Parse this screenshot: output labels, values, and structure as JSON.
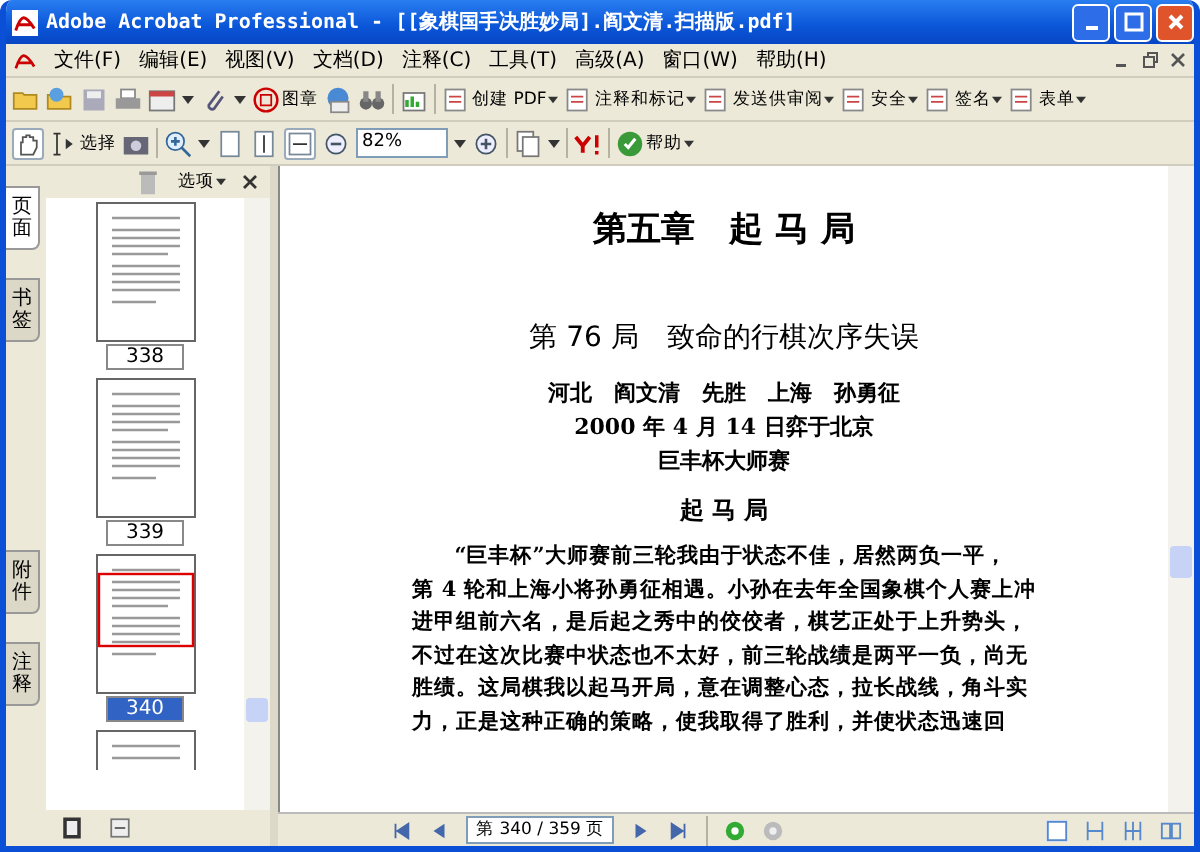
{
  "window": {
    "title": "Adobe Acrobat Professional - [[象棋国手决胜妙局].阎文清.扫描版.pdf]"
  },
  "menu": [
    "文件(F)",
    "编辑(E)",
    "视图(V)",
    "文档(D)",
    "注释(C)",
    "工具(T)",
    "高级(A)",
    "窗口(W)",
    "帮助(H)"
  ],
  "toolbar": {
    "stamp": "图章",
    "tasks": [
      "创建 PDF",
      "注释和标记",
      "发送供审阅",
      "安全",
      "签名",
      "表单"
    ]
  },
  "toolbar2": {
    "select": "选择",
    "zoom": "82%",
    "help": "帮助"
  },
  "side_tabs": [
    {
      "label": "页面",
      "selected": true
    },
    {
      "label": "书签",
      "selected": false
    },
    {
      "label": "附件",
      "selected": false
    },
    {
      "label": "注释",
      "selected": false
    }
  ],
  "panel": {
    "options": "选项",
    "thumbnails": [
      {
        "page": "338",
        "selected": false
      },
      {
        "page": "339",
        "selected": false
      },
      {
        "page": "340",
        "selected": true
      }
    ]
  },
  "document": {
    "chapter": "第五章　起 马 局",
    "game": "第 76 局　致命的行棋次序失误",
    "players": "河北　阎文清　先胜　上海　孙勇征",
    "date": "2000 年 4 月 14 日弈于北京",
    "event": "巨丰杯大师赛",
    "section": "起 马 局",
    "paragraph": [
      "“巨丰杯”大师赛前三轮我由于状态不佳，居然两负一平，",
      "第 4 轮和上海小将孙勇征相遇。小孙在去年全国象棋个人赛上冲",
      "进甲组前六名，是后起之秀中的佼佼者，棋艺正处于上升势头，",
      "不过在这次比赛中状态也不太好，前三轮战绩是两平一负，尚无",
      "胜绩。这局棋我以起马开局，意在调整心态，拉长战线，角斗实",
      "力，正是这种正确的策略，使我取得了胜利，并使状态迅速回"
    ]
  },
  "status_bar": {
    "page_field": "第 340 / 359 页"
  }
}
